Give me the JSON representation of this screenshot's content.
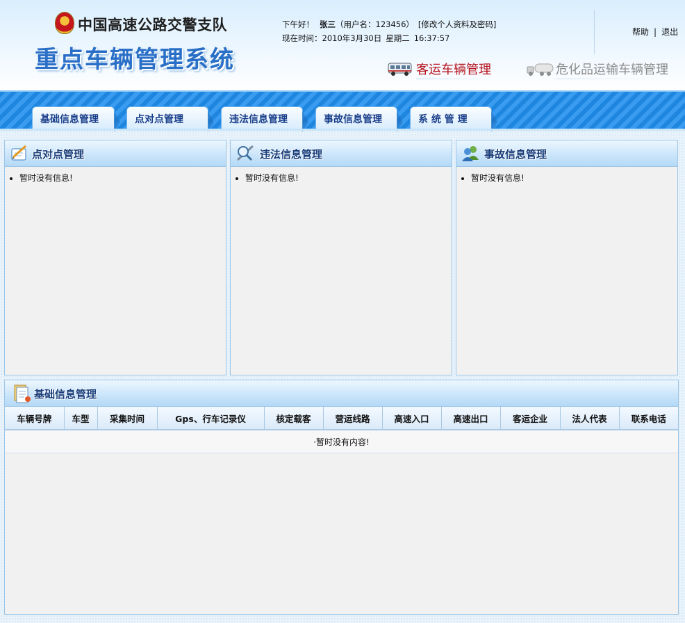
{
  "header": {
    "org_name": "中国高速公路交警支队",
    "system_title": "重点车辆管理系统",
    "greeting": "下午好！",
    "user_name": "张三",
    "user_id": "（用户名：123456）",
    "edit_profile": "[修改个人资料及密码]",
    "time_label": "现在时间：",
    "date": "2010年3月30日",
    "weekday": "星期二",
    "time": "16:37:57",
    "help": "帮助",
    "separator": "|",
    "logout": "退出",
    "module_passenger": "客运车辆管理",
    "module_hazard": "危化品运输车辆管理"
  },
  "nav": {
    "tabs": [
      {
        "label": "基础信息管理"
      },
      {
        "label": "点对点管理"
      },
      {
        "label": "违法信息管理"
      },
      {
        "label": "事故信息管理"
      },
      {
        "label": "系 统 管 理"
      }
    ]
  },
  "panels": {
    "p2p": {
      "title": "点对点管理",
      "message": "暂时没有信息!"
    },
    "violation": {
      "title": "违法信息管理",
      "message": "暂时没有信息!"
    },
    "accident": {
      "title": "事故信息管理",
      "message": "暂时没有信息!"
    }
  },
  "basic_info": {
    "title": "基础信息管理",
    "columns": [
      "车辆号牌",
      "车型",
      "采集时间",
      "Gps、行车记录仪",
      "核定载客",
      "营运线路",
      "高速入口",
      "高速出口",
      "客运企业",
      "法人代表",
      "联系电话"
    ],
    "empty_message": "·暂时没有内容!"
  },
  "colors": {
    "title_blue": "#2a6fc7",
    "nav_blue": "#2a8ee8",
    "passenger_red": "#b5121b",
    "panel_bg": "#f1f1f1"
  }
}
